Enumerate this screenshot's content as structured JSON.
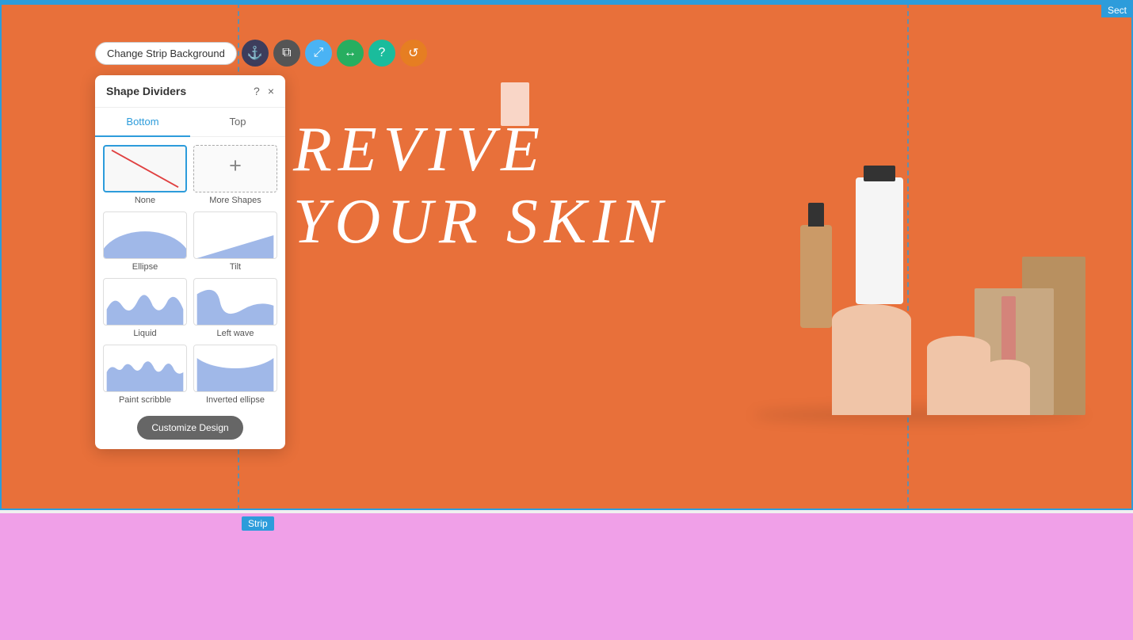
{
  "topBorder": {
    "color": "#2d9cdb"
  },
  "sectionLabel": {
    "text": "Sect"
  },
  "toolbar": {
    "changeBackgroundBtn": "Change Strip Background",
    "icons": [
      {
        "name": "anchor-icon",
        "symbol": "⚓",
        "colorClass": "icon-btn-dark"
      },
      {
        "name": "copy-icon",
        "symbol": "⧉",
        "colorClass": "icon-btn-gray"
      },
      {
        "name": "resize-icon",
        "symbol": "⤢",
        "colorClass": "icon-btn-blue"
      },
      {
        "name": "link-icon",
        "symbol": "↔",
        "colorClass": "icon-btn-green"
      },
      {
        "name": "help-icon",
        "symbol": "?",
        "colorClass": "icon-btn-teal"
      },
      {
        "name": "refresh-icon",
        "symbol": "↺",
        "colorClass": "icon-btn-orange"
      }
    ]
  },
  "shapeDividersPanel": {
    "title": "Shape Dividers",
    "helpIcon": "?",
    "closeIcon": "×",
    "tabs": [
      {
        "label": "Bottom",
        "active": true
      },
      {
        "label": "Top",
        "active": false
      }
    ],
    "shapes": [
      {
        "id": "none",
        "label": "None",
        "type": "none",
        "selected": true
      },
      {
        "id": "more",
        "label": "More Shapes",
        "type": "more",
        "selected": false
      },
      {
        "id": "ellipse",
        "label": "Ellipse",
        "type": "ellipse",
        "selected": false
      },
      {
        "id": "tilt",
        "label": "Tilt",
        "type": "tilt",
        "selected": false
      },
      {
        "id": "liquid",
        "label": "Liquid",
        "type": "liquid",
        "selected": false
      },
      {
        "id": "left-wave",
        "label": "Left wave",
        "type": "left-wave",
        "selected": false
      },
      {
        "id": "paint-scribble",
        "label": "Paint scribble",
        "type": "paint-scribble",
        "selected": false
      },
      {
        "id": "inverted-ellipse",
        "label": "Inverted ellipse",
        "type": "inverted-ellipse",
        "selected": false
      }
    ],
    "customizeBtn": "Customize Design"
  },
  "hero": {
    "line1": "REVIVE",
    "line2": "YOUR SKIN",
    "background": "#e8703a"
  },
  "stripLabel": "Strip",
  "pinkSection": {
    "background": "#f5a0ef"
  }
}
